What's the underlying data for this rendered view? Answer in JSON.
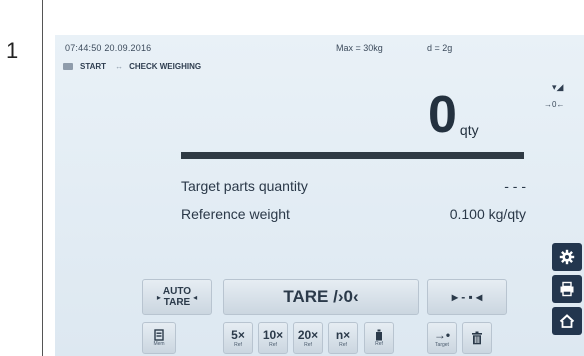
{
  "step_number": "1",
  "header": {
    "datetime": "07:44:50 20.09.2016",
    "max": "Max = 30kg",
    "d": "d = 2g"
  },
  "breadcrumb": {
    "start": "START",
    "arrow": "↔",
    "mode": "CHECK WEIGHING"
  },
  "status": {
    "scale_icon": "▾◢",
    "zero_indicator": "→0←"
  },
  "reading": {
    "value": "0",
    "unit": "qty",
    "bar_fraction": 1.0
  },
  "info": {
    "target_label": "Target parts quantity",
    "target_value": "- - -",
    "reference_label": "Reference weight",
    "reference_value": "0.100 kg/qty"
  },
  "buttons": {
    "auto_line1": "AUTO",
    "auto_line2": "TARE",
    "auto_arrow_left": "▸",
    "auto_arrow_right": "◂",
    "tare_label": "TARE /›0‹",
    "center_label": "▸ - ▪ ◂"
  },
  "toolbar": {
    "mem_label": "Mem",
    "ref5_main": "5×",
    "ref10_main": "10×",
    "ref20_main": "20×",
    "refn_main": "n×",
    "ref_sub": "Ref",
    "target_main": "→•",
    "target_sub": "Target"
  },
  "icons": {
    "settings": "gear-icon",
    "print": "printer-icon",
    "home": "home-icon",
    "mem": "memory-icon",
    "ref_weight": "weight-icon",
    "delete": "trash-icon"
  },
  "colors": {
    "screen_bg": "#e3ecf4",
    "side_button": "#23364e",
    "bar": "#2f3a44"
  }
}
